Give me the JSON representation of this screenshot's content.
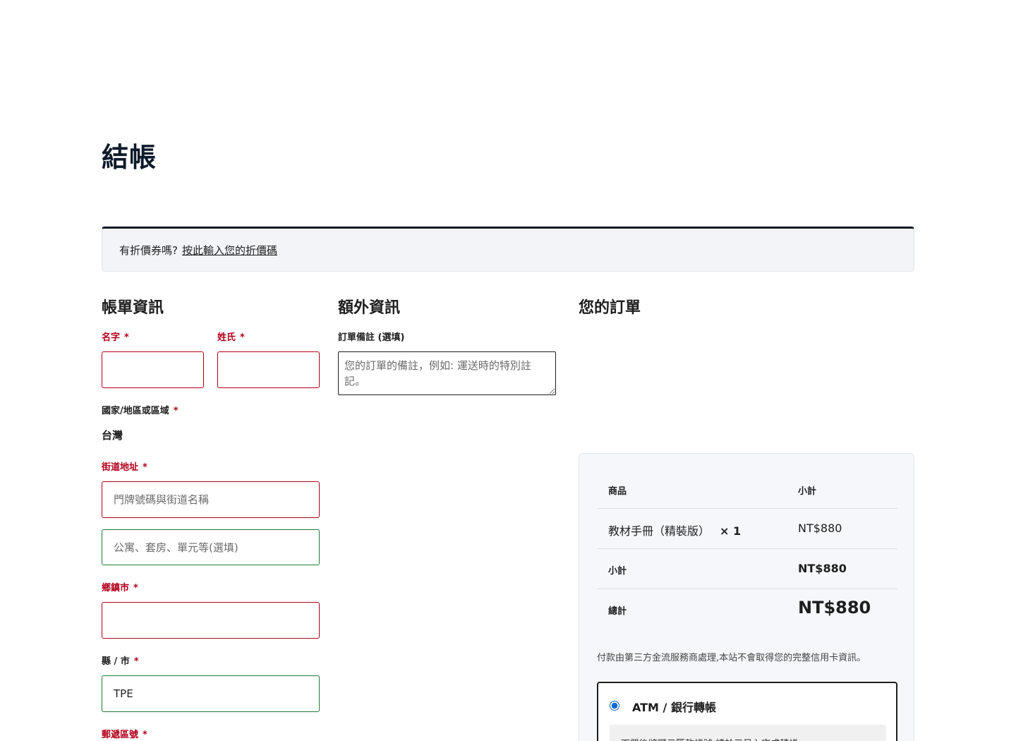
{
  "page": {
    "title": "結帳"
  },
  "coupon": {
    "prompt": "有折價券嗎?",
    "link": "按此輸入您的折價碼"
  },
  "billing": {
    "heading": "帳單資訊",
    "first_name": {
      "label": "名字",
      "value": ""
    },
    "last_name": {
      "label": "姓氏",
      "value": ""
    },
    "country": {
      "label": "國家/地區或區域",
      "value": "台灣"
    },
    "address": {
      "label": "街道地址",
      "line1_placeholder": "門牌號碼與街道名稱",
      "line2_placeholder": "公寓、套房、單元等(選填)"
    },
    "city": {
      "label": "鄉鎮市",
      "value": ""
    },
    "state": {
      "label": "縣 / 市",
      "value": "TPE"
    },
    "postcode": {
      "label": "郵遞區號"
    },
    "required_mark": "*"
  },
  "extra": {
    "heading": "額外資訊",
    "notes_label": "訂單備註 (選填)",
    "notes_placeholder": "您的訂單的備註，例如: 運送時的特別註記。"
  },
  "order": {
    "heading": "您的訂單",
    "col_product": "商品",
    "col_subtotal": "小計",
    "items": [
      {
        "name": "教材手冊（精裝版）",
        "qty": "× 1",
        "price": "NT$880"
      }
    ],
    "subtotal_label": "小計",
    "subtotal_value": "NT$880",
    "total_label": "總計",
    "total_value": "NT$880"
  },
  "payment": {
    "note": "付款由第三方金流服務商處理,本站不會取得您的完整信用卡資訊。",
    "method_label": "ATM / 銀行轉帳",
    "method_desc": "下單後將顯示匯款帳號,請於三日內完成轉帳。",
    "accent": "#0a66d9"
  },
  "colors": {
    "error": "#b3001b",
    "valid": "#1e7b35",
    "heading": "#0f1a2b"
  }
}
